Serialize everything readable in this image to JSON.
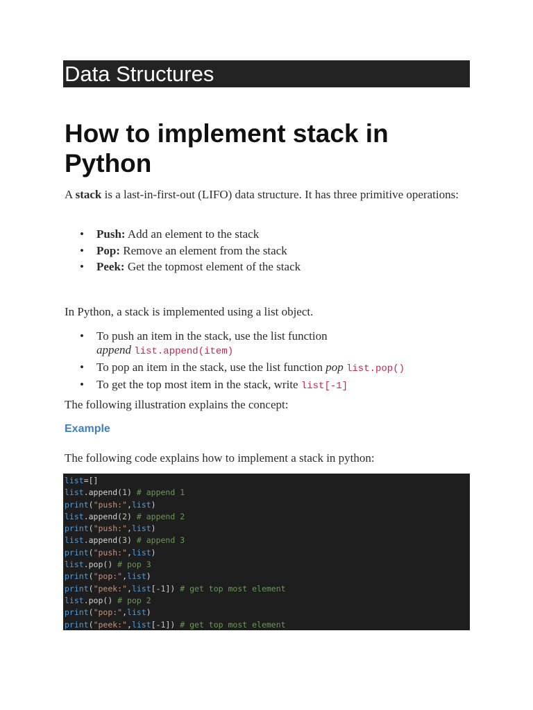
{
  "category_banner": "Data Structures",
  "article": {
    "title": "How to implement stack in Python",
    "intro": {
      "prefix": "A ",
      "bold": "stack",
      "suffix": " is a last-in-first-out (LIFO) data structure. It has three primitive operations:"
    },
    "operations": [
      {
        "name": "Push:",
        "desc": " Add an element to the stack"
      },
      {
        "name": "Pop:",
        "desc": " Remove an element from the stack"
      },
      {
        "name": "Peek:",
        "desc": " Get the topmost element of the stack"
      }
    ],
    "python_intro": "In Python, a stack is implemented using a list object.",
    "python_items": [
      {
        "text": "To push an item in the stack, use the list function ",
        "italic": "append",
        "code": "list.append(item)"
      },
      {
        "text": "To pop an item in the stack, use the list function ",
        "italic": "pop",
        "code": "list.pop()"
      },
      {
        "text": "To get the top most item in the stack, write ",
        "italic": "",
        "code": "list[-1]"
      }
    ],
    "illustration_text": "The following illustration explains the concept:",
    "example_heading": "Example",
    "code_intro": "The following code explains how to implement a stack in python:"
  },
  "code_lines": [
    [
      [
        "kw",
        "list"
      ],
      [
        "txt",
        "=[]"
      ]
    ],
    [
      [
        "kw",
        "list"
      ],
      [
        "txt",
        ".append("
      ],
      [
        "num",
        "1"
      ],
      [
        "txt",
        ") "
      ],
      [
        "com",
        "# append 1"
      ]
    ],
    [
      [
        "kw",
        "print"
      ],
      [
        "txt",
        "("
      ],
      [
        "str",
        "\"push:\""
      ],
      [
        "txt",
        ","
      ],
      [
        "kw",
        "list"
      ],
      [
        "txt",
        ")"
      ]
    ],
    [
      [
        "kw",
        "list"
      ],
      [
        "txt",
        ".append("
      ],
      [
        "num",
        "2"
      ],
      [
        "txt",
        ") "
      ],
      [
        "com",
        "# append 2"
      ]
    ],
    [
      [
        "kw",
        "print"
      ],
      [
        "txt",
        "("
      ],
      [
        "str",
        "\"push:\""
      ],
      [
        "txt",
        ","
      ],
      [
        "kw",
        "list"
      ],
      [
        "txt",
        ")"
      ]
    ],
    [
      [
        "kw",
        "list"
      ],
      [
        "txt",
        ".append("
      ],
      [
        "num",
        "3"
      ],
      [
        "txt",
        ") "
      ],
      [
        "com",
        "# append 3"
      ]
    ],
    [
      [
        "kw",
        "print"
      ],
      [
        "txt",
        "("
      ],
      [
        "str",
        "\"push:\""
      ],
      [
        "txt",
        ","
      ],
      [
        "kw",
        "list"
      ],
      [
        "txt",
        ")"
      ]
    ],
    [
      [
        "kw",
        "list"
      ],
      [
        "txt",
        ".pop() "
      ],
      [
        "com",
        "# pop 3"
      ]
    ],
    [
      [
        "kw",
        "print"
      ],
      [
        "txt",
        "("
      ],
      [
        "str",
        "\"pop:\""
      ],
      [
        "txt",
        ","
      ],
      [
        "kw",
        "list"
      ],
      [
        "txt",
        ")"
      ]
    ],
    [
      [
        "kw",
        "print"
      ],
      [
        "txt",
        "("
      ],
      [
        "str",
        "\"peek:\""
      ],
      [
        "txt",
        ","
      ],
      [
        "kw",
        "list"
      ],
      [
        "txt",
        "[-"
      ],
      [
        "num",
        "1"
      ],
      [
        "txt",
        "]) "
      ],
      [
        "com",
        "# get top most element"
      ]
    ],
    [
      [
        "kw",
        "list"
      ],
      [
        "txt",
        ".pop() "
      ],
      [
        "com",
        "# pop 2"
      ]
    ],
    [
      [
        "kw",
        "print"
      ],
      [
        "txt",
        "("
      ],
      [
        "str",
        "\"pop:\""
      ],
      [
        "txt",
        ","
      ],
      [
        "kw",
        "list"
      ],
      [
        "txt",
        ")"
      ]
    ],
    [
      [
        "kw",
        "print"
      ],
      [
        "txt",
        "("
      ],
      [
        "str",
        "\"peek:\""
      ],
      [
        "txt",
        ","
      ],
      [
        "kw",
        "list"
      ],
      [
        "txt",
        "[-"
      ],
      [
        "num",
        "1"
      ],
      [
        "txt",
        "]) "
      ],
      [
        "com",
        "# get top most element"
      ]
    ]
  ],
  "colors": {
    "banner_bg": "#232323",
    "code_bg": "#1e1e1e",
    "inline_code": "#c7254e",
    "example_heading": "#3f7fbf",
    "code_keyword": "#569cd6",
    "code_string": "#ce9178",
    "code_number": "#b5cea8",
    "code_comment": "#6a9955"
  }
}
